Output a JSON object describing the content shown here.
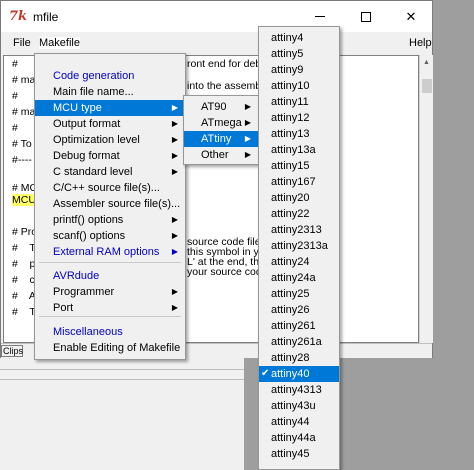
{
  "window": {
    "title": "mfile",
    "app_icon": "tk-feather-icon",
    "icon_glyph": "7k"
  },
  "menubar": {
    "file": "File",
    "makefile": "Makefile",
    "help": "Help"
  },
  "editor": {
    "lines": [
      "#",
      "# ma",
      "#",
      "# ma",
      "#",
      "# To",
      "#----",
      "",
      "# MC",
      "MCU",
      "",
      "# Pro",
      "#    T",
      "#    p",
      "#    c",
      "#    A",
      "#    T"
    ],
    "right_lines": [
      "ront end for debu",
      "into the assemb",
      "source code files",
      "this symbol in yo",
      "L' at the end, thi",
      "your source cod"
    ]
  },
  "statusbar": {
    "label": "Clips"
  },
  "makefile_menu": {
    "items": [
      {
        "label": "Code generation",
        "style": "blue",
        "submenu": false
      },
      {
        "label": "Main file name...",
        "style": "normal",
        "submenu": false
      },
      {
        "label": "MCU type",
        "style": "selected",
        "submenu": true
      },
      {
        "label": "Output format",
        "style": "normal",
        "submenu": true
      },
      {
        "label": "Optimization level",
        "style": "normal",
        "submenu": true
      },
      {
        "label": "Debug format",
        "style": "normal",
        "submenu": true
      },
      {
        "label": "C standard level",
        "style": "normal",
        "submenu": true
      },
      {
        "label": "C/C++ source file(s)...",
        "style": "normal",
        "submenu": false
      },
      {
        "label": "Assembler source file(s)...",
        "style": "normal",
        "submenu": false
      },
      {
        "label": "printf() options",
        "style": "normal",
        "submenu": true
      },
      {
        "label": "scanf() options",
        "style": "normal",
        "submenu": true
      },
      {
        "label": "External RAM options",
        "style": "blue",
        "submenu": true
      },
      {
        "label": "AVRdude",
        "style": "blue",
        "submenu": false
      },
      {
        "label": "Programmer",
        "style": "normal",
        "submenu": true
      },
      {
        "label": "Port",
        "style": "normal",
        "submenu": true
      },
      {
        "label": "Miscellaneous",
        "style": "blue",
        "submenu": false
      },
      {
        "label": "Enable Editing of Makefile",
        "style": "normal",
        "submenu": false
      }
    ]
  },
  "mcu_menu": {
    "items": [
      {
        "label": "AT90",
        "selected": false
      },
      {
        "label": "ATmega",
        "selected": false
      },
      {
        "label": "ATtiny",
        "selected": true
      },
      {
        "label": "Other",
        "selected": false
      }
    ]
  },
  "attiny_menu": {
    "checked": "attiny40",
    "items": [
      "attiny4",
      "attiny5",
      "attiny9",
      "attiny10",
      "attiny11",
      "attiny12",
      "attiny13",
      "attiny13a",
      "attiny15",
      "attiny167",
      "attiny20",
      "attiny22",
      "attiny2313",
      "attiny2313a",
      "attiny24",
      "attiny24a",
      "attiny25",
      "attiny26",
      "attiny261",
      "attiny261a",
      "attiny28",
      "attiny40",
      "attiny4313",
      "attiny43u",
      "attiny44",
      "attiny44a",
      "attiny45"
    ]
  },
  "colors": {
    "selection": "#0078d7",
    "section_header": "#0000c8",
    "highlight": "#ffff66"
  }
}
